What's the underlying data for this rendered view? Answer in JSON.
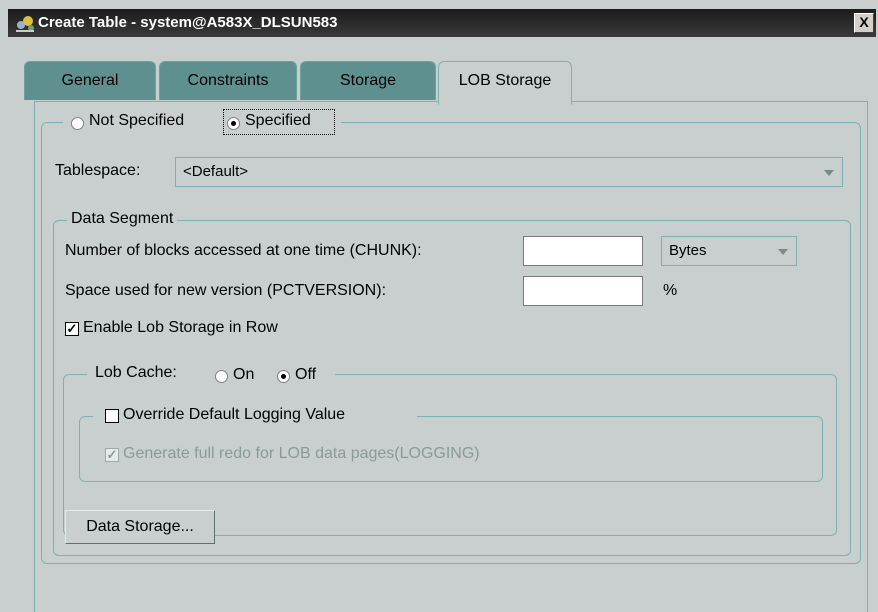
{
  "window": {
    "title": "Create Table - system@A583X_DLSUN583",
    "close_label": "X"
  },
  "tabs": [
    {
      "label": "General",
      "active": false
    },
    {
      "label": "Constraints",
      "active": false
    },
    {
      "label": "Storage",
      "active": false
    },
    {
      "label": "LOB Storage",
      "active": true
    }
  ],
  "lob_storage": {
    "option_not_specified": "Not Specified",
    "option_specified": "Specified",
    "selected_option": "Specified",
    "tablespace_label": "Tablespace:",
    "tablespace_value": "<Default>"
  },
  "data_segment": {
    "title": "Data Segment",
    "chunk_label": "Number of blocks accessed at one time (CHUNK):",
    "chunk_value": "",
    "chunk_unit": "Bytes",
    "pctversion_label": "Space used for new version (PCTVERSION):",
    "pctversion_value": "",
    "pctversion_unit": "%",
    "enable_in_row_label": "Enable Lob Storage in Row",
    "enable_in_row_checked": true
  },
  "lob_cache": {
    "label": "Lob Cache:",
    "option_on": "On",
    "option_off": "Off",
    "selected": "Off"
  },
  "logging": {
    "override_label": "Override Default Logging Value",
    "override_checked": false,
    "generate_redo_label": "Generate full redo for LOB data pages(LOGGING)",
    "generate_redo_checked": true,
    "generate_redo_enabled": false
  },
  "buttons": {
    "data_storage": "Data Storage..."
  },
  "colors": {
    "window_bg": "#c9cfcf",
    "tab_inactive": "#5f9090",
    "border_accent": "#7fb0b0",
    "titlebar": "#1c1c1c",
    "disabled_text": "#8a9a9a"
  }
}
